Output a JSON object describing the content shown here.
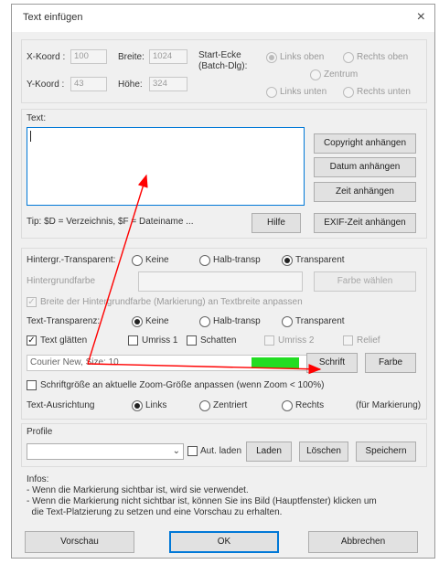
{
  "dialog": {
    "title": "Text einfügen",
    "close_glyph": "×"
  },
  "position": {
    "x_label": "X-Koord :",
    "x_value": "100",
    "y_label": "Y-Koord :",
    "y_value": "43",
    "width_label": "Breite:",
    "width_value": "1024",
    "height_label": "Höhe:",
    "height_value": "324",
    "corner_label_1": "Start-Ecke",
    "corner_label_2": "(Batch-Dlg):",
    "corner_options": [
      "Links oben",
      "Rechts oben",
      "Zentrum",
      "Links unten",
      "Rechts unten"
    ],
    "corner_selected": "Links oben"
  },
  "text": {
    "group_label": "Text:",
    "value": "",
    "buttons": [
      "Copyright anhängen",
      "Datum anhängen",
      "Zeit anhängen",
      "EXIF-Zeit anhängen"
    ],
    "tip": "Tip: $D = Verzeichnis, $F = Dateiname ...",
    "help_button": "Hilfe"
  },
  "background": {
    "label": "Hintergr.-Transparent:",
    "options": [
      "Keine",
      "Halb-transp",
      "Transparent"
    ],
    "selected": "Transparent",
    "color_label": "Hintergrundfarbe",
    "choose_color_button": "Farbe wählen",
    "fit_checkbox_label": "Breite der Hintergrundfarbe (Markierung) an Textbreite anpassen"
  },
  "text_transparency": {
    "label": "Text-Transparenz:",
    "options": [
      "Keine",
      "Halb-transp",
      "Transparent"
    ],
    "selected": "Keine"
  },
  "effects": {
    "smooth_label": "Text glätten",
    "smooth_checked": "✓",
    "outline1_label": "Umriss 1",
    "shadow_label": "Schatten",
    "outline2_label": "Umriss 2",
    "relief_label": "Relief"
  },
  "font": {
    "value": "Courier New, Size: 10",
    "swatch_color": "#22dd22",
    "font_button": "Schrift",
    "color_button": "Farbe",
    "zoom_checkbox_label": "Schriftgröße an aktuelle Zoom-Größe anpassen (wenn Zoom < 100%)"
  },
  "alignment": {
    "label": "Text-Ausrichtung",
    "options": [
      "Links",
      "Zentriert",
      "Rechts"
    ],
    "selected": "Links",
    "note": "(für Markierung)"
  },
  "profile": {
    "group_label": "Profile",
    "selected": "",
    "autoload_label": "Aut. laden",
    "buttons": [
      "Laden",
      "Löschen",
      "Speichern"
    ]
  },
  "info": {
    "label": "Infos:",
    "line1": "- Wenn die Markierung sichtbar ist, wird sie verwendet.",
    "line2": "- Wenn die Markierung nicht sichtbar ist, können Sie ins Bild (Hauptfenster) klicken um",
    "line3": "  die Text-Platzierung zu setzen und eine Vorschau zu erhalten."
  },
  "footer": {
    "preview": "Vorschau",
    "ok": "OK",
    "cancel": "Abbrechen"
  },
  "accent_color": "#0078d7",
  "annotation_arrow_color": "#ff0000"
}
